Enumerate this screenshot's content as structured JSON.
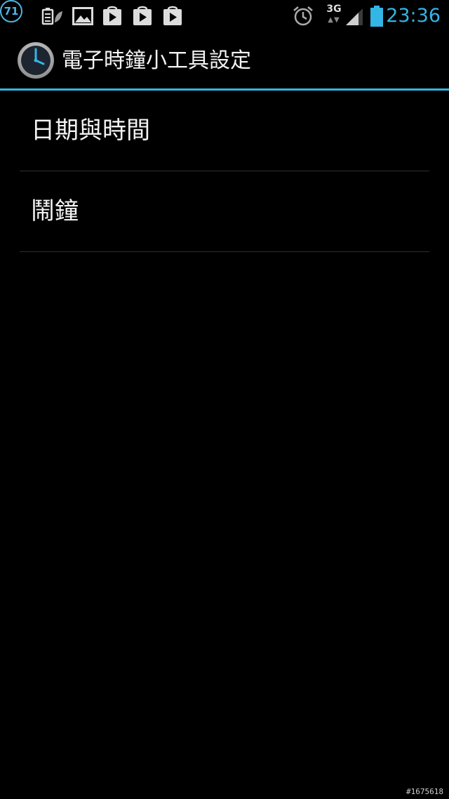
{
  "status_bar": {
    "notification_count": "71",
    "icons": [
      "notification-count-badge-icon",
      "battery-saver-icon",
      "gallery-icon",
      "play-store-icon",
      "play-store-icon",
      "play-store-icon",
      "alarm-clock-icon",
      "signal-3g-icon",
      "cell-signal-icon",
      "battery-icon"
    ],
    "network": "3G",
    "time": "23:36"
  },
  "action_bar": {
    "title": "電子時鐘小工具設定",
    "icon": "clock-icon"
  },
  "settings": {
    "items": [
      {
        "label": "日期與時間"
      },
      {
        "label": "鬧鐘"
      }
    ]
  },
  "watermark": "#1675618",
  "colors": {
    "accent": "#33b5e5",
    "background": "#000000",
    "text": "#f4f4f4",
    "divider": "#2e2e2e"
  }
}
